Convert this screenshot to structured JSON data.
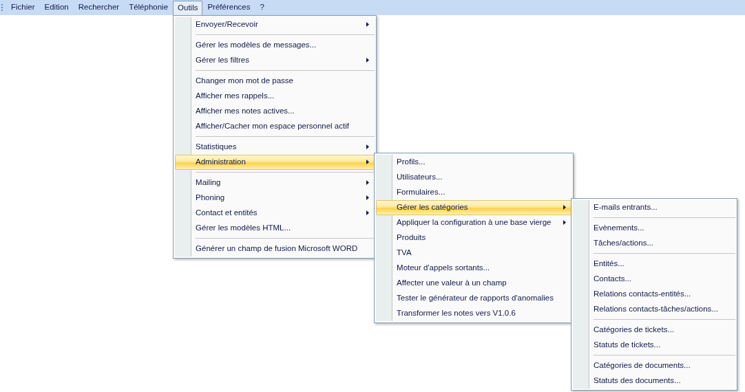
{
  "menubar": [
    {
      "label": "Fichier",
      "selected": false
    },
    {
      "label": "Edition",
      "selected": false
    },
    {
      "label": "Rechercher",
      "selected": false
    },
    {
      "label": "Téléphonie",
      "selected": false
    },
    {
      "label": "Outils",
      "selected": true,
      "menu": {
        "items": [
          {
            "kind": "item",
            "label": "Envoyer/Recevoir",
            "has_submenu": true,
            "selected": false
          },
          {
            "kind": "separator"
          },
          {
            "kind": "item",
            "label": "Gérer les modèles de messages...",
            "has_submenu": false,
            "selected": false
          },
          {
            "kind": "item",
            "label": "Gérer les filtres",
            "has_submenu": true,
            "selected": false
          },
          {
            "kind": "separator"
          },
          {
            "kind": "item",
            "label": "Changer mon mot de passe",
            "has_submenu": false,
            "selected": false
          },
          {
            "kind": "item",
            "label": "Afficher mes rappels...",
            "has_submenu": false,
            "selected": false
          },
          {
            "kind": "item",
            "label": "Afficher mes notes actives...",
            "has_submenu": false,
            "selected": false
          },
          {
            "kind": "item",
            "label": "Afficher/Cacher mon espace personnel actif",
            "has_submenu": false,
            "selected": false
          },
          {
            "kind": "separator"
          },
          {
            "kind": "item",
            "label": "Statistiques",
            "has_submenu": true,
            "selected": false
          },
          {
            "kind": "item",
            "label": "Administration",
            "has_submenu": true,
            "selected": true,
            "submenu": {
              "items": [
                {
                  "kind": "item",
                  "label": "Profils...",
                  "has_submenu": false,
                  "selected": false
                },
                {
                  "kind": "item",
                  "label": "Utilisateurs...",
                  "has_submenu": false,
                  "selected": false
                },
                {
                  "kind": "item",
                  "label": "Formulaires...",
                  "has_submenu": false,
                  "selected": false
                },
                {
                  "kind": "item",
                  "label": "Gérer les catégories",
                  "has_submenu": true,
                  "selected": true,
                  "submenu": {
                    "items": [
                      {
                        "kind": "item",
                        "label": "E-mails entrants...",
                        "has_submenu": false,
                        "selected": false
                      },
                      {
                        "kind": "separator"
                      },
                      {
                        "kind": "item",
                        "label": "Evènements...",
                        "has_submenu": false,
                        "selected": false
                      },
                      {
                        "kind": "item",
                        "label": "Tâches/actions...",
                        "has_submenu": false,
                        "selected": false
                      },
                      {
                        "kind": "separator"
                      },
                      {
                        "kind": "item",
                        "label": "Entités...",
                        "has_submenu": false,
                        "selected": false
                      },
                      {
                        "kind": "item",
                        "label": "Contacts...",
                        "has_submenu": false,
                        "selected": false
                      },
                      {
                        "kind": "item",
                        "label": "Relations contacts-entités...",
                        "has_submenu": false,
                        "selected": false
                      },
                      {
                        "kind": "item",
                        "label": "Relations contacts-tâches/actions...",
                        "has_submenu": false,
                        "selected": false
                      },
                      {
                        "kind": "separator"
                      },
                      {
                        "kind": "item",
                        "label": "Catégories de tickets...",
                        "has_submenu": false,
                        "selected": false
                      },
                      {
                        "kind": "item",
                        "label": "Statuts de tickets...",
                        "has_submenu": false,
                        "selected": false
                      },
                      {
                        "kind": "separator"
                      },
                      {
                        "kind": "item",
                        "label": "Catégories de documents...",
                        "has_submenu": false,
                        "selected": false
                      },
                      {
                        "kind": "item",
                        "label": "Statuts des documents...",
                        "has_submenu": false,
                        "selected": false
                      }
                    ]
                  }
                },
                {
                  "kind": "item",
                  "label": "Appliquer la configuration à une base vierge",
                  "has_submenu": true,
                  "selected": false
                },
                {
                  "kind": "item",
                  "label": "Produits",
                  "has_submenu": false,
                  "selected": false
                },
                {
                  "kind": "item",
                  "label": "TVA",
                  "has_submenu": false,
                  "selected": false
                },
                {
                  "kind": "item",
                  "label": "Moteur d'appels sortants...",
                  "has_submenu": false,
                  "selected": false
                },
                {
                  "kind": "item",
                  "label": "Affecter une valeur à un champ",
                  "has_submenu": false,
                  "selected": false
                },
                {
                  "kind": "item",
                  "label": "Tester le générateur de rapports d'anomalies",
                  "has_submenu": false,
                  "selected": false
                },
                {
                  "kind": "item",
                  "label": "Transformer les notes vers V1.0.6",
                  "has_submenu": false,
                  "selected": false
                }
              ]
            }
          },
          {
            "kind": "separator"
          },
          {
            "kind": "item",
            "label": "Mailing",
            "has_submenu": true,
            "selected": false
          },
          {
            "kind": "item",
            "label": "Phoning",
            "has_submenu": true,
            "selected": false
          },
          {
            "kind": "item",
            "label": "Contact et entités",
            "has_submenu": true,
            "selected": false
          },
          {
            "kind": "item",
            "label": "Gérer les modèles HTML...",
            "has_submenu": false,
            "selected": false
          },
          {
            "kind": "separator"
          },
          {
            "kind": "item",
            "label": "Générer un champ de fusion Microsoft WORD",
            "has_submenu": false,
            "selected": false
          }
        ]
      }
    },
    {
      "label": "Préférences",
      "selected": false
    },
    {
      "label": "?",
      "selected": false
    }
  ]
}
